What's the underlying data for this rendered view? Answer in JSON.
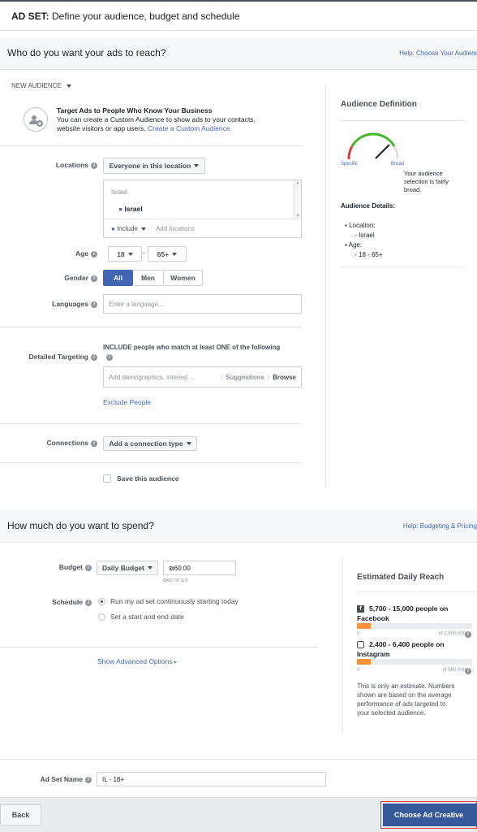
{
  "header": {
    "prefix": "AD SET:",
    "title": "Define your audience, budget and schedule"
  },
  "audience_section": {
    "heading": "Who do you want your ads to reach?",
    "help_link": "Help: Choose Your Audience",
    "new_audience_label": "NEW AUDIENCE",
    "custom_audience": {
      "title": "Target Ads to People Who Know Your Business",
      "line1": "You can create a Custom Audience to show ads to your contacts,",
      "line2": "website visitors or app users.",
      "link": "Create a Custom Audience."
    },
    "locations": {
      "label": "Locations",
      "dropdown": "Everyone in this location",
      "country_header": "Israel",
      "selected": "Israel",
      "include": "Include",
      "add_placeholder": "Add locations"
    },
    "age": {
      "label": "Age",
      "min": "18",
      "max": "65+",
      "dash": "-"
    },
    "gender": {
      "label": "Gender",
      "options": [
        "All",
        "Men",
        "Women"
      ],
      "selected": "All"
    },
    "languages": {
      "label": "Languages",
      "placeholder": "Enter a language..."
    },
    "detailed_targeting": {
      "label": "Detailed Targeting",
      "include_text": "INCLUDE people who match at least ONE of the following",
      "placeholder": "Add demographics, interest ...",
      "suggestions": "Suggestions",
      "browse": "Browse",
      "exclude": "Exclude People"
    },
    "connections": {
      "label": "Connections",
      "dropdown": "Add a connection type"
    },
    "save_audience": "Save this audience"
  },
  "audience_definition": {
    "title": "Audience Definition",
    "specific": "Specific",
    "broad": "Broad",
    "gauge_text": [
      "Your audience",
      "selection is fairly",
      "broad."
    ],
    "details_title": "Audience Details:",
    "location_label": "Location:",
    "location_value": "Israel",
    "age_label": "Age:",
    "age_value": "18 - 65+"
  },
  "budget_section": {
    "heading": "How much do you want to spend?",
    "help_link": "Help: Budgeting & Pricing",
    "budget": {
      "label": "Budget",
      "type": "Daily Budget",
      "value": "₪60.00",
      "sub": "₪60.00 ILS"
    },
    "schedule": {
      "label": "Schedule",
      "options": [
        "Run my ad set continuously starting today",
        "Set a start and end date"
      ],
      "selected": 0
    },
    "advanced": "Show Advanced Options"
  },
  "estimated_reach": {
    "title": "Estimated Daily Reach",
    "facebook": {
      "text": "5,700 - 15,000 people on",
      "platform": "Facebook",
      "min": "0",
      "max": "of 2,900,000",
      "fill": 0.12
    },
    "instagram": {
      "text": "2,400 - 6,400 people on",
      "platform": "Instagram",
      "min": "0",
      "max": "of 580,000",
      "fill": 0.12
    },
    "note": [
      "This is only an estimate. Numbers",
      "shown are based on the average",
      "performance of ads targeted to",
      "your selected audience."
    ]
  },
  "ad_set_name": {
    "label": "Ad Set Name",
    "value": "IL - 18+"
  },
  "footer": {
    "back": "Back",
    "next": "Choose Ad Creative"
  },
  "colors": {
    "accent": "#4267b2",
    "primary_button": "#365899",
    "highlight_border": "#e0393e",
    "reach_bar": "#f7923b"
  }
}
